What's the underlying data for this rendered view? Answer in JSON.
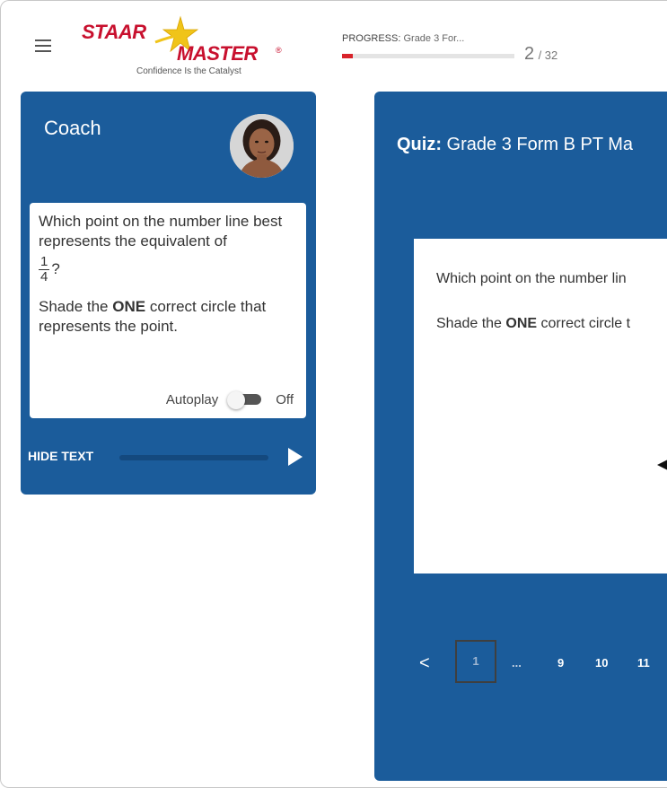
{
  "header": {
    "menu_icon": "hamburger-menu-icon",
    "logo": {
      "word1": "STAAR",
      "word2": "MASTER",
      "reg": "®",
      "tagline": "Confidence Is the Catalyst",
      "brand_color": "#c8102e",
      "star_color": "#f0c419"
    },
    "progress": {
      "label": "PROGRESS:",
      "title": "Grade 3 For...",
      "current": "2",
      "total": "/ 32",
      "fraction": 0.0625,
      "fill_color": "#d8232a"
    }
  },
  "coach": {
    "title": "Coach",
    "question_line": "Which point on the number line best represents the equivalent of",
    "fraction": {
      "numerator": "1",
      "denominator": "4"
    },
    "question_mark": "?",
    "instruction_pre": "Shade the ",
    "instruction_bold": "ONE",
    "instruction_post": " correct circle that represents the point.",
    "autoplay_label": "Autoplay",
    "autoplay_state": "Off",
    "hide_text_label": "HIDE TEXT",
    "panel_color": "#1b5c9b"
  },
  "quiz": {
    "title_bold": "Quiz:",
    "title": " Grade 3 Form B PT Ma",
    "question_line": "Which point on the number lin",
    "instruction_pre": "Shade the ",
    "instruction_bold": "ONE",
    "instruction_post": " correct circle t",
    "pager": {
      "prev": "<",
      "current": "1",
      "ellipsis": "...",
      "pages": [
        "9",
        "10",
        "11"
      ]
    }
  }
}
